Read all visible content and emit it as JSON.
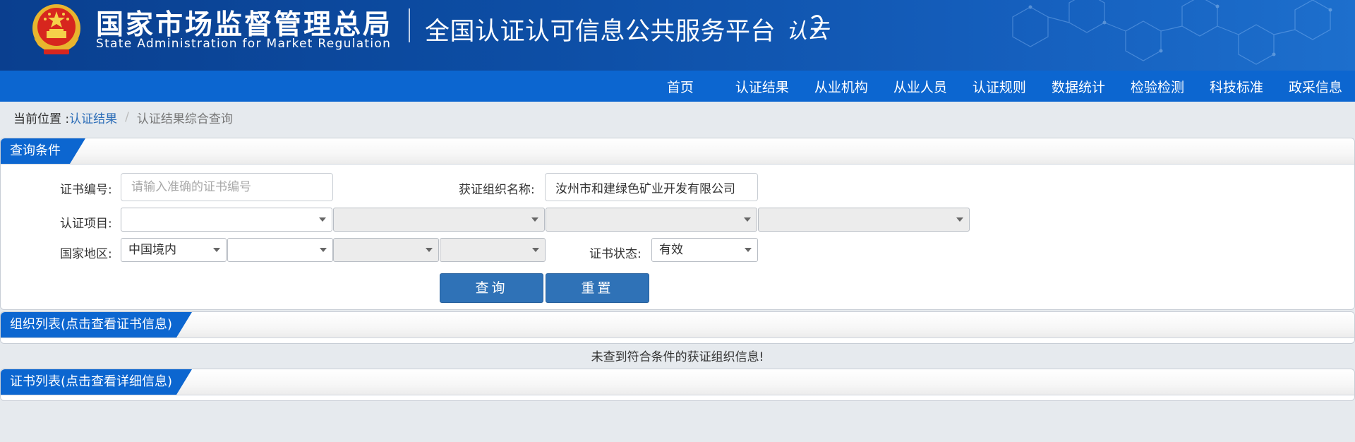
{
  "header": {
    "org_name_cn": "国家市场监督管理总局",
    "org_name_en": "State Administration  for  Market Regulation",
    "platform_title": "全国认证认可信息公共服务平台",
    "logo_text": "认云"
  },
  "nav": {
    "items": [
      "首页",
      "认证结果",
      "从业机构",
      "从业人员",
      "认证规则",
      "数据统计",
      "检验检测",
      "科技标准",
      "政采信息"
    ]
  },
  "breadcrumb": {
    "prefix": "当前位置 : ",
    "link": "认证结果",
    "separator": "/",
    "current": "认证结果综合查询"
  },
  "query_panel": {
    "title": "查询条件",
    "cert_no_label": "证书编号:",
    "cert_no_placeholder": "请输入准确的证书编号",
    "cert_no_value": "",
    "org_name_label": "获证组织名称:",
    "org_name_value": "汝州市和建绿色矿业开发有限公司",
    "project_label": "认证项目:",
    "project_selects": [
      "",
      "",
      "",
      ""
    ],
    "region_label": "国家地区:",
    "region_selects": [
      "中国境内",
      "",
      "",
      ""
    ],
    "status_label": "证书状态:",
    "status_value": "有效",
    "search_button": "查询",
    "reset_button": "重置"
  },
  "org_list_panel": {
    "title": "组织列表(点击查看证书信息)",
    "empty_message": "未查到符合条件的获证组织信息!"
  },
  "cert_list_panel": {
    "title": "证书列表(点击查看详细信息)"
  },
  "colors": {
    "header_blue": "#0d4ea5",
    "nav_blue": "#0c66d0",
    "button_blue": "#2f72b7",
    "link_blue": "#2f6fb8",
    "page_bg": "#e6eaee"
  }
}
